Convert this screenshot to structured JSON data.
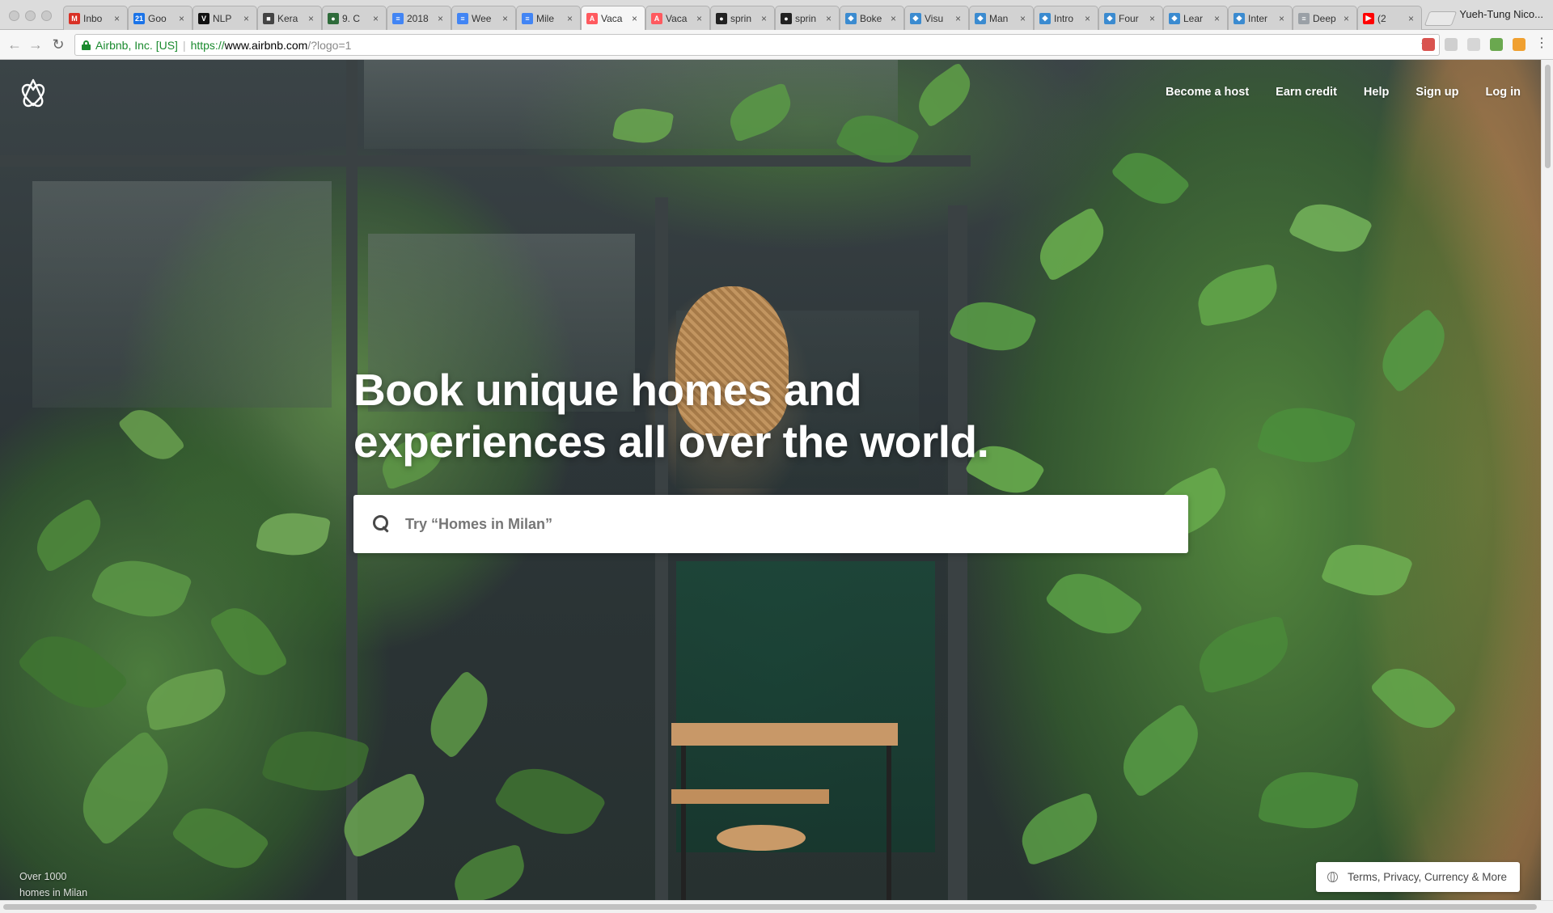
{
  "browser": {
    "profile_name": "Yueh-Tung Nico...",
    "tabs": [
      {
        "title": "Inbo",
        "icon": "gmail-icon",
        "color": "#d93025",
        "glyph": "M"
      },
      {
        "title": "Goo",
        "icon": "google-calendar-icon",
        "color": "#1a73e8",
        "glyph": "21"
      },
      {
        "title": "NLP",
        "icon": "v-logo-icon",
        "color": "#111111",
        "glyph": "V"
      },
      {
        "title": "Kera",
        "icon": "cube-icon",
        "color": "#444444",
        "glyph": "■"
      },
      {
        "title": "9. C",
        "icon": "globe-icon",
        "color": "#2e6b3a",
        "glyph": "●"
      },
      {
        "title": "2018",
        "icon": "docs-icon",
        "color": "#4285f4",
        "glyph": "≡"
      },
      {
        "title": "Wee",
        "icon": "docs-icon",
        "color": "#4285f4",
        "glyph": "≡"
      },
      {
        "title": "Mile",
        "icon": "docs-icon",
        "color": "#4285f4",
        "glyph": "≡"
      },
      {
        "title": "Vaca",
        "icon": "airbnb-icon",
        "color": "#ff5a5f",
        "glyph": "A",
        "active": true
      },
      {
        "title": "Vaca",
        "icon": "airbnb-icon",
        "color": "#ff5a5f",
        "glyph": "A"
      },
      {
        "title": "sprin",
        "icon": "github-icon",
        "color": "#222222",
        "glyph": "●"
      },
      {
        "title": "sprin",
        "icon": "github-icon",
        "color": "#222222",
        "glyph": "●"
      },
      {
        "title": "Boke",
        "icon": "shield-icon",
        "color": "#3b8bd0",
        "glyph": "◆"
      },
      {
        "title": "Visu",
        "icon": "shield-icon",
        "color": "#3b8bd0",
        "glyph": "◆"
      },
      {
        "title": "Man",
        "icon": "shield-icon",
        "color": "#3b8bd0",
        "glyph": "◆"
      },
      {
        "title": "Intro",
        "icon": "shield-icon",
        "color": "#3b8bd0",
        "glyph": "◆"
      },
      {
        "title": "Four",
        "icon": "shield-icon",
        "color": "#3b8bd0",
        "glyph": "◆"
      },
      {
        "title": "Lear",
        "icon": "shield-icon",
        "color": "#3b8bd0",
        "glyph": "◆"
      },
      {
        "title": "Inter",
        "icon": "shield-icon",
        "color": "#3b8bd0",
        "glyph": "◆"
      },
      {
        "title": "Deep",
        "icon": "doc-icon",
        "color": "#9aa0a6",
        "glyph": "≡"
      },
      {
        "title": "(2",
        "icon": "youtube-icon",
        "color": "#ff0000",
        "glyph": "▶"
      }
    ],
    "address": {
      "ev_label": "Airbnb, Inc. [US]",
      "scheme": "https://",
      "host": "www.airbnb.com",
      "path": "/?logo=1"
    }
  },
  "page": {
    "nav": {
      "become_host": "Become a host",
      "earn_credit": "Earn credit",
      "help": "Help",
      "sign_up": "Sign up",
      "log_in": "Log in"
    },
    "headline": {
      "line1": "Book unique homes and",
      "line2": "experiences all over the world."
    },
    "search": {
      "placeholder": "Try “Homes in Milan”",
      "value": ""
    },
    "photo_caption": {
      "line1": "Over 1000",
      "line2": "homes in Milan"
    },
    "footer_button": "Terms, Privacy, Currency & More",
    "brand_color": "#ff5a5f"
  }
}
